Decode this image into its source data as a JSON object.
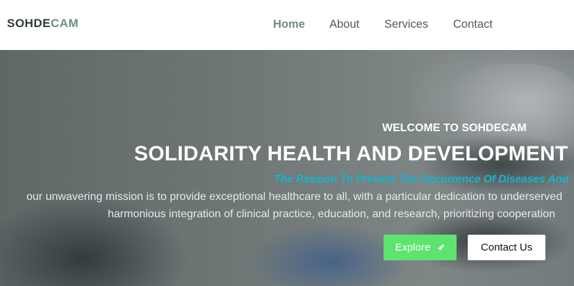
{
  "brand": {
    "name_prefix": "SOHDE",
    "name_suffix": "CAM"
  },
  "nav": {
    "items": [
      {
        "label": "Home",
        "active": true
      },
      {
        "label": "About",
        "active": false
      },
      {
        "label": "Services",
        "active": false
      },
      {
        "label": "Contact",
        "active": false
      }
    ]
  },
  "hero": {
    "welcome": "WELCOME TO SOHDECAM",
    "headline": "SOLIDARITY HEALTH AND DEVELOPMENT CAMEROON",
    "tagline": "The Passion To Prevent The Occurrence Of Diseases And",
    "description_line1": "our unwavering mission is to provide exceptional healthcare to all, with a particular dedication to underserved",
    "description_line2": "harmonious integration of clinical practice, education, and research, prioritizing cooperation",
    "buttons": {
      "explore_label": "Explore",
      "explore_icon": "rocket-icon",
      "contact_label": "Contact Us"
    }
  },
  "colors": {
    "brand_accent": "#6d8c88",
    "tagline": "#12b6cf",
    "explore_button": "#5ee36f"
  }
}
